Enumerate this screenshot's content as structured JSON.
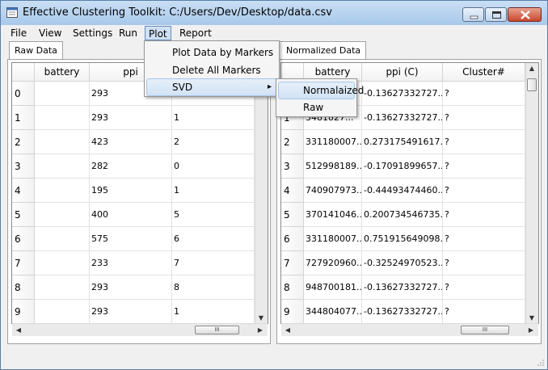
{
  "window": {
    "title": "Effective Clustering Toolkit: C:/Users/Dev/Desktop/data.csv"
  },
  "menubar": [
    "File",
    "View",
    "Settings",
    "Run",
    "Plot",
    "Report"
  ],
  "plot_menu": {
    "items": [
      "Plot Data by Markers",
      "Delete All Markers",
      "SVD"
    ],
    "submenu_arrow": "▸",
    "svd_submenu": [
      "Normalaized",
      "Raw"
    ]
  },
  "left_panel": {
    "tab": "Raw Data",
    "columns": [
      "battery",
      "ppi",
      ""
    ],
    "rows": [
      {
        "index": "0",
        "cells": [
          "",
          "293",
          ""
        ]
      },
      {
        "index": "1",
        "cells": [
          "",
          "293",
          "1"
        ]
      },
      {
        "index": "2",
        "cells": [
          "",
          "423",
          "2"
        ]
      },
      {
        "index": "3",
        "cells": [
          "",
          "282",
          "0"
        ]
      },
      {
        "index": "4",
        "cells": [
          "",
          "195",
          "1"
        ]
      },
      {
        "index": "5",
        "cells": [
          "",
          "400",
          "5"
        ]
      },
      {
        "index": "6",
        "cells": [
          "",
          "575",
          "6"
        ]
      },
      {
        "index": "7",
        "cells": [
          "",
          "233",
          "7"
        ]
      },
      {
        "index": "8",
        "cells": [
          "",
          "293",
          "8"
        ]
      },
      {
        "index": "9",
        "cells": [
          "",
          "293",
          "1"
        ]
      }
    ]
  },
  "right_panel": {
    "tab": "Normalized Data",
    "columns": [
      "battery",
      "ppi (C)",
      "Cluster#"
    ],
    "rows": [
      {
        "index": "",
        "cells": [
          "",
          "-0.13627332727...",
          "?"
        ]
      },
      {
        "index": "1",
        "cells": [
          "3481827...",
          "-0.13627332727...",
          "?"
        ]
      },
      {
        "index": "2",
        "cells": [
          "331180007...",
          "0.273175491617...",
          "?"
        ]
      },
      {
        "index": "3",
        "cells": [
          "512998189...",
          "-0.17091899657...",
          "?"
        ]
      },
      {
        "index": "4",
        "cells": [
          "740907973...",
          "-0.44493474460...",
          "?"
        ]
      },
      {
        "index": "5",
        "cells": [
          "370141046...",
          "0.200734546735...",
          "?"
        ]
      },
      {
        "index": "6",
        "cells": [
          "331180007...",
          "0.751915649098...",
          "?"
        ]
      },
      {
        "index": "7",
        "cells": [
          "727920960...",
          "-0.32524970523...",
          "?"
        ]
      },
      {
        "index": "8",
        "cells": [
          "948700181...",
          "-0.13627332727...",
          "?"
        ]
      },
      {
        "index": "9",
        "cells": [
          "344804077...",
          "-0.13627332727...",
          "?"
        ]
      }
    ]
  },
  "scrollbar": {
    "thumb_grip": "III",
    "up_arrow": "▲",
    "down_arrow": "▼",
    "left_arrow": "◀",
    "right_arrow": "▶"
  },
  "colors": {
    "titlebar": "#b9d4f0",
    "menu_highlight": "#cfe0f4",
    "close_button": "#c9462e"
  }
}
